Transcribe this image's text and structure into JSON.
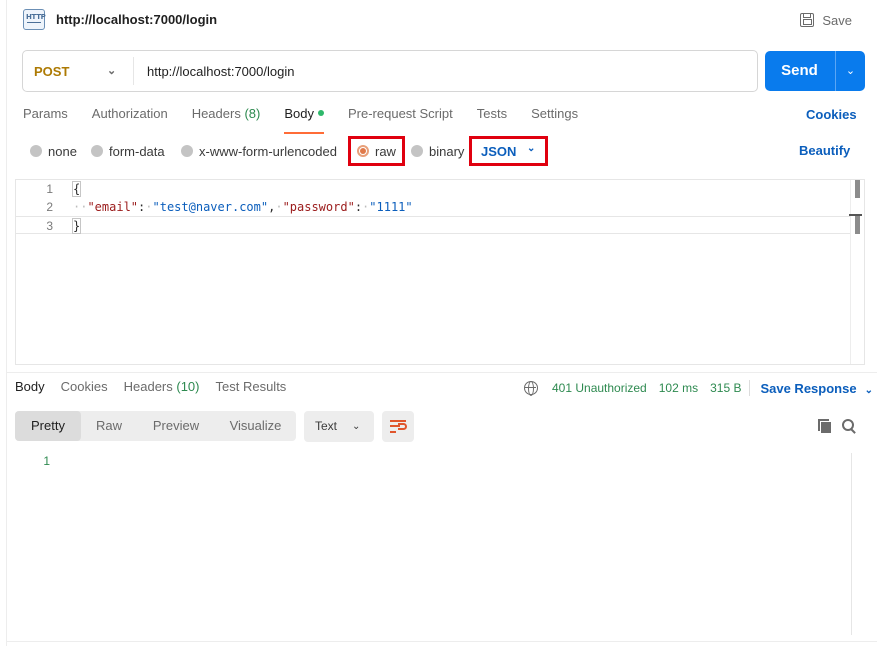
{
  "request": {
    "title": "http://localhost:7000/login",
    "save_label": "Save",
    "method": "POST",
    "url": "http://localhost:7000/login",
    "send_label": "Send",
    "icon": "http-icon"
  },
  "request_tabs": [
    {
      "label": "Params"
    },
    {
      "label": "Authorization"
    },
    {
      "label": "Headers",
      "count": "(8)"
    },
    {
      "label": "Body"
    },
    {
      "label": "Pre-request Script"
    },
    {
      "label": "Tests"
    },
    {
      "label": "Settings"
    }
  ],
  "cookies_label": "Cookies",
  "body_types": {
    "none": "none",
    "form_data": "form-data",
    "urlencoded": "x-www-form-urlencoded",
    "raw": "raw",
    "binary": "binary",
    "selected": "raw"
  },
  "language": "JSON",
  "beautify_label": "Beautify",
  "editor": {
    "line_numbers": [
      "1",
      "2",
      "3"
    ],
    "open_brace": "{",
    "key_email": "\"email\"",
    "val_email": "\"test@naver.com\"",
    "key_password": "\"password\"",
    "val_password": "\"1111\"",
    "close_brace": "}"
  },
  "response_tabs": [
    {
      "label": "Body"
    },
    {
      "label": "Cookies"
    },
    {
      "label": "Headers",
      "count": "(10)"
    },
    {
      "label": "Test Results"
    }
  ],
  "response_status": {
    "code": "401 Unauthorized",
    "time": "102 ms",
    "size": "315 B",
    "save_response": "Save Response"
  },
  "view_modes": [
    "Pretty",
    "Raw",
    "Preview",
    "Visualize"
  ],
  "active_view": "Pretty",
  "format": "Text",
  "response_line": "1",
  "colors": {
    "accent": "#ff6c37",
    "send": "#097bed",
    "link": "#0b5ebc",
    "success": "#2e8a50",
    "method": "#ad7a03",
    "highlight": "#e0000f"
  }
}
